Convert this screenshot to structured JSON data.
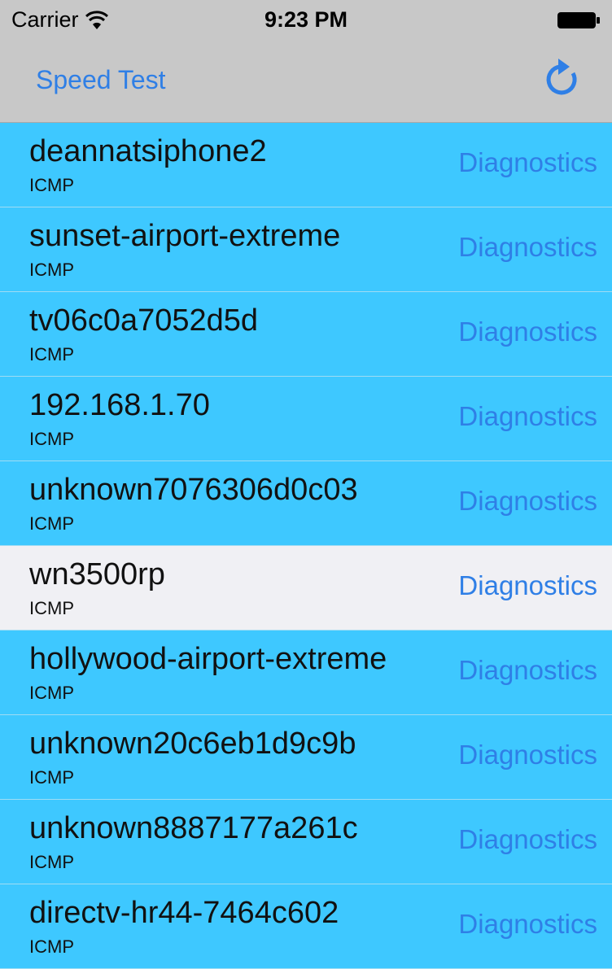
{
  "status_bar": {
    "carrier": "Carrier",
    "time": "9:23 PM"
  },
  "nav": {
    "left_label": "Speed Test",
    "right_icon": "refresh-icon"
  },
  "rows": [
    {
      "title": "deannatsiphone2",
      "subtitle": "ICMP",
      "action": "Diagnostics"
    },
    {
      "title": "sunset-airport-extreme",
      "subtitle": "ICMP",
      "action": "Diagnostics"
    },
    {
      "title": "tv06c0a7052d5d",
      "subtitle": "ICMP",
      "action": "Diagnostics"
    },
    {
      "title": "192.168.1.70",
      "subtitle": "ICMP",
      "action": "Diagnostics"
    },
    {
      "title": "unknown7076306d0c03",
      "subtitle": "ICMP",
      "action": "Diagnostics"
    },
    {
      "title": "wn3500rp",
      "subtitle": "ICMP",
      "action": "Diagnostics"
    },
    {
      "title": "hollywood-airport-extreme",
      "subtitle": "ICMP",
      "action": "Diagnostics"
    },
    {
      "title": "unknown20c6eb1d9c9b",
      "subtitle": "ICMP",
      "action": "Diagnostics"
    },
    {
      "title": "unknown8887177a261c",
      "subtitle": "ICMP",
      "action": "Diagnostics"
    },
    {
      "title": "directv-hr44-7464c602",
      "subtitle": "ICMP",
      "action": "Diagnostics"
    }
  ],
  "colors": {
    "row_background": "#3ec8ff",
    "selected_row_background": "#f0f0f4",
    "accent": "#2f7fe6",
    "bar_background": "#c8c8c8"
  }
}
